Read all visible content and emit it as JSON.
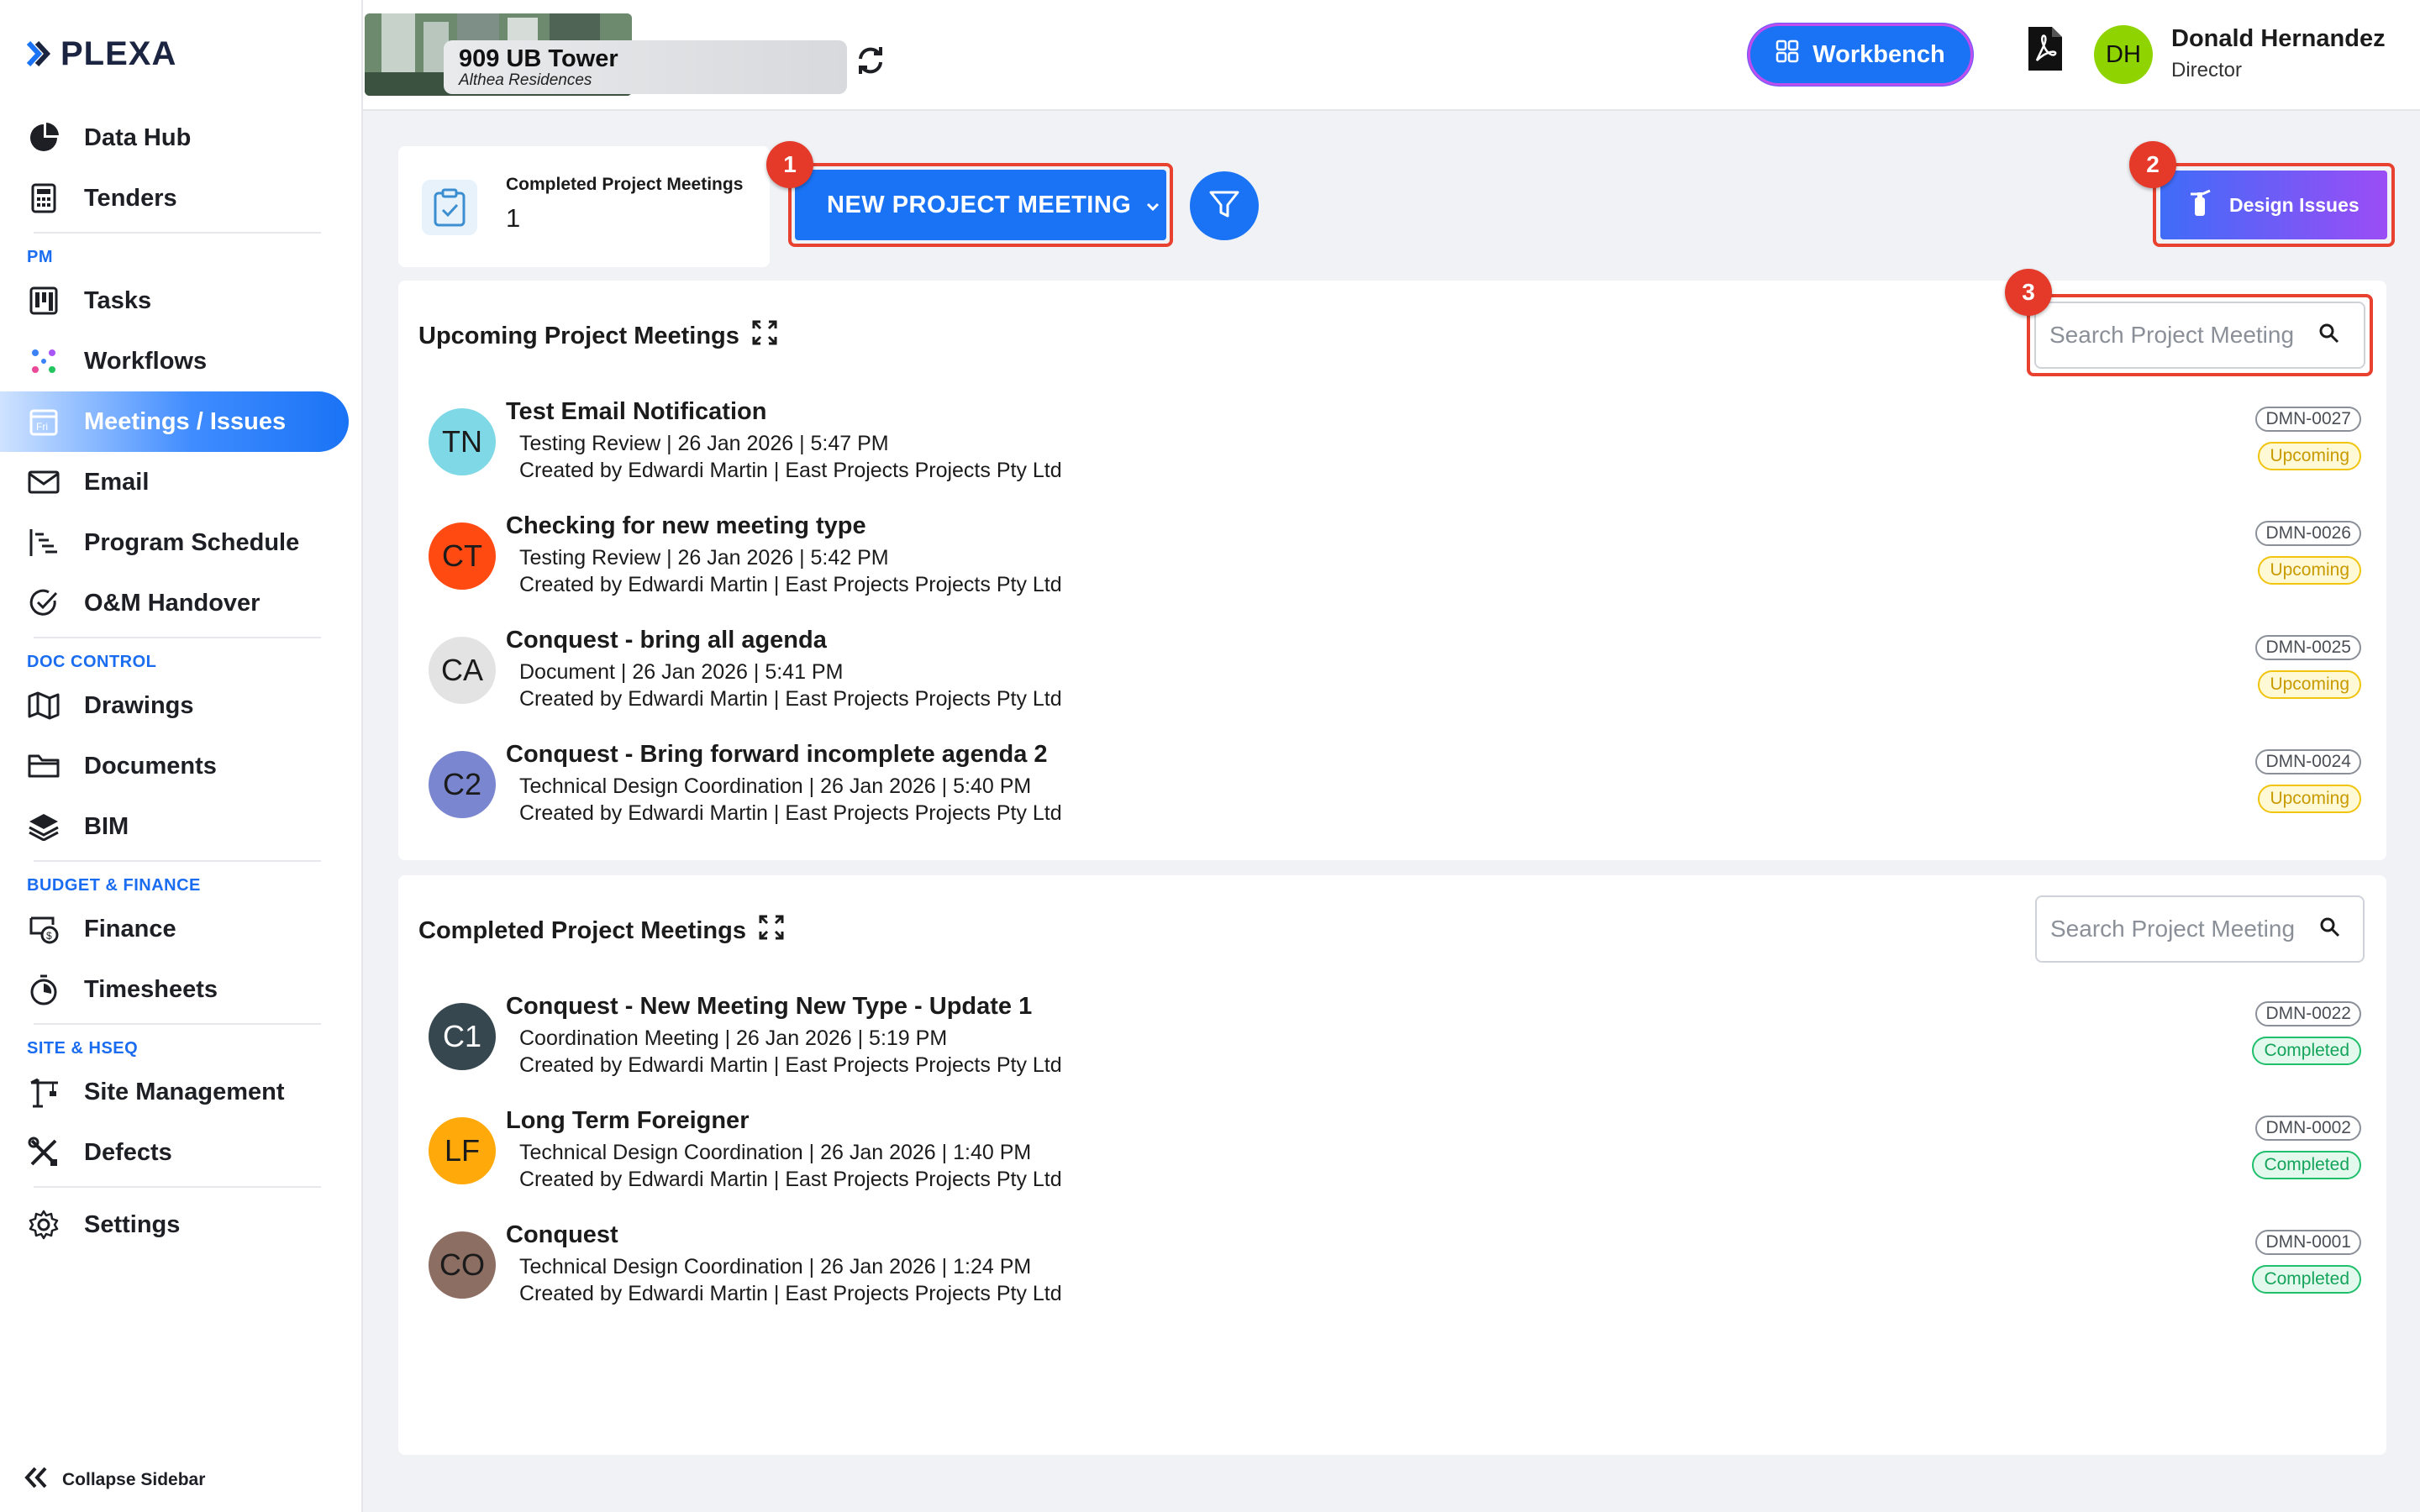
{
  "brand": {
    "name": "PLEXA",
    "accent": "#1a73f5"
  },
  "sidebar": {
    "items": [
      {
        "label": "Data Hub",
        "icon": "pie-chart-icon"
      },
      {
        "label": "Tenders",
        "icon": "calculator-icon"
      },
      {
        "section": "PM"
      },
      {
        "label": "Tasks",
        "icon": "kanban-icon"
      },
      {
        "label": "Workflows",
        "icon": "workflow-icon"
      },
      {
        "label": "Meetings / Issues",
        "icon": "calendar-icon",
        "active": true
      },
      {
        "label": "Email",
        "icon": "envelope-icon"
      },
      {
        "label": "Program Schedule",
        "icon": "gantt-icon"
      },
      {
        "label": "O&M Handover",
        "icon": "check-circle-icon"
      },
      {
        "section": "DOC CONTROL"
      },
      {
        "label": "Drawings",
        "icon": "map-icon"
      },
      {
        "label": "Documents",
        "icon": "folder-icon"
      },
      {
        "label": "BIM",
        "icon": "layers-icon"
      },
      {
        "section": "BUDGET & FINANCE"
      },
      {
        "label": "Finance",
        "icon": "finance-icon"
      },
      {
        "label": "Timesheets",
        "icon": "stopwatch-icon"
      },
      {
        "section": "SITE & HSEQ"
      },
      {
        "label": "Site Management",
        "icon": "crane-icon"
      },
      {
        "label": "Defects",
        "icon": "tools-icon"
      },
      {
        "label": "Settings",
        "icon": "gear-icon"
      }
    ],
    "collapse_label": "Collapse Sidebar"
  },
  "header": {
    "project_name": "909 UB Tower",
    "project_sub": "Althea Residences",
    "workbench_label": "Workbench",
    "user_initials": "DH",
    "user_name": "Donald Hernandez",
    "user_role": "Director"
  },
  "toolbar": {
    "stat_title": "Completed Project Meetings",
    "stat_value": "1",
    "new_meeting_label": "NEW PROJECT MEETING",
    "design_issues_label": "Design Issues",
    "markers": [
      "1",
      "2",
      "3"
    ]
  },
  "upcoming": {
    "title": "Upcoming Project Meetings",
    "search_placeholder": "Search Project Meeting",
    "meetings": [
      {
        "initials": "TN",
        "color": "#7fd8e6",
        "title": "Test Email Notification",
        "line1": "Testing Review | 26 Jan 2026 | 5:47 PM",
        "line2": "Created by Edwardi Martin | East Projects Projects Pty Ltd",
        "code": "DMN-0027",
        "status": "Upcoming"
      },
      {
        "initials": "CT",
        "color": "#ff4a12",
        "title": "Checking for new meeting type",
        "line1": "Testing Review | 26 Jan 2026 | 5:42 PM",
        "line2": "Created by Edwardi Martin | East Projects Projects Pty Ltd",
        "code": "DMN-0026",
        "status": "Upcoming"
      },
      {
        "initials": "CA",
        "color": "#e3e3e3",
        "title": "Conquest - bring all agenda",
        "line1": "Document | 26 Jan 2026 | 5:41 PM",
        "line2": "Created by Edwardi Martin | East Projects Projects Pty Ltd",
        "code": "DMN-0025",
        "status": "Upcoming"
      },
      {
        "initials": "C2",
        "color": "#7a86cf",
        "title": "Conquest - Bring forward incomplete agenda 2",
        "line1": "Technical Design Coordination | 26 Jan 2026 | 5:40 PM",
        "line2": "Created by Edwardi Martin | East Projects Projects Pty Ltd",
        "code": "DMN-0024",
        "status": "Upcoming"
      }
    ]
  },
  "completed": {
    "title": "Completed Project Meetings",
    "search_placeholder": "Search Project Meeting",
    "meetings": [
      {
        "initials": "C1",
        "color": "#37474f",
        "text_color": "#ffffff",
        "title": "Conquest - New Meeting New Type - Update 1",
        "line1": "Coordination Meeting | 26 Jan 2026 | 5:19 PM",
        "line2": "Created by Edwardi Martin | East Projects Projects Pty Ltd",
        "code": "DMN-0022",
        "status": "Completed"
      },
      {
        "initials": "LF",
        "color": "#ffa90a",
        "title": "Long Term Foreigner",
        "line1": "Technical Design Coordination | 26 Jan 2026 | 1:40 PM",
        "line2": "Created by Edwardi Martin | East Projects Projects Pty Ltd",
        "code": "DMN-0002",
        "status": "Completed"
      },
      {
        "initials": "CO",
        "color": "#8d6e63",
        "title": "Conquest",
        "line1": "Technical Design Coordination | 26 Jan 2026 | 1:24 PM",
        "line2": "Created by Edwardi Martin | East Projects Projects Pty Ltd",
        "code": "DMN-0001",
        "status": "Completed"
      }
    ]
  }
}
